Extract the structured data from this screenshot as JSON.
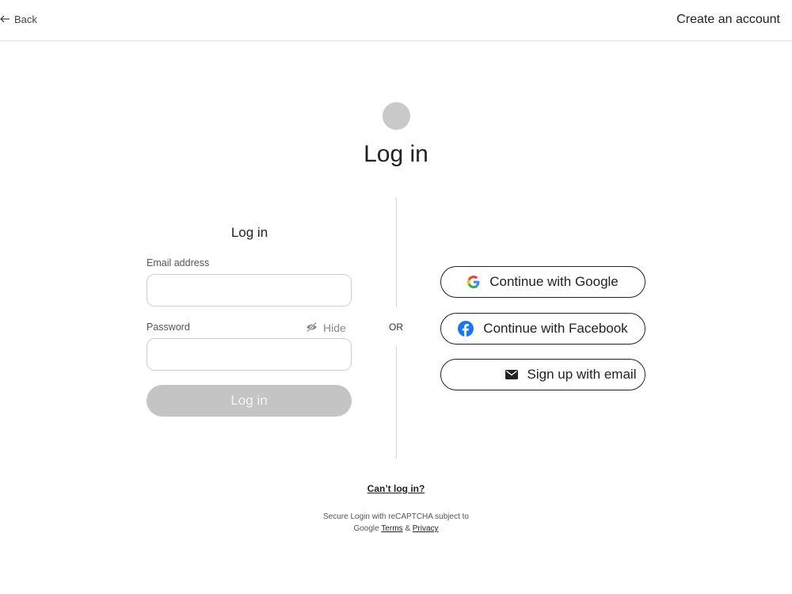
{
  "topbar": {
    "back_label": "Back",
    "create_account_label": "Create an account"
  },
  "page": {
    "title": "Log in"
  },
  "form": {
    "title": "Log in",
    "email_label": "Email address",
    "email_value": "",
    "password_label": "Password",
    "password_value": "",
    "hide_label": "Hide",
    "login_button": "Log in"
  },
  "divider": {
    "or_label": "OR"
  },
  "social": {
    "google": "Continue with Google",
    "facebook": "Continue with Facebook",
    "email": "Sign up with email"
  },
  "footer": {
    "cant_login": "Can’t log in?",
    "legal_line1": "Secure Login with reCAPTCHA subject to",
    "legal_prefix": "Google",
    "terms": "Terms",
    "amp": "&",
    "privacy": "Privacy"
  },
  "colors": {
    "disabled_button": "#c4c4c4",
    "facebook_blue": "#1877f2"
  },
  "icons": {
    "back": "arrow-left-icon",
    "hide": "eye-slash-icon",
    "google": "google-icon",
    "facebook": "facebook-icon",
    "email": "envelope-icon"
  }
}
